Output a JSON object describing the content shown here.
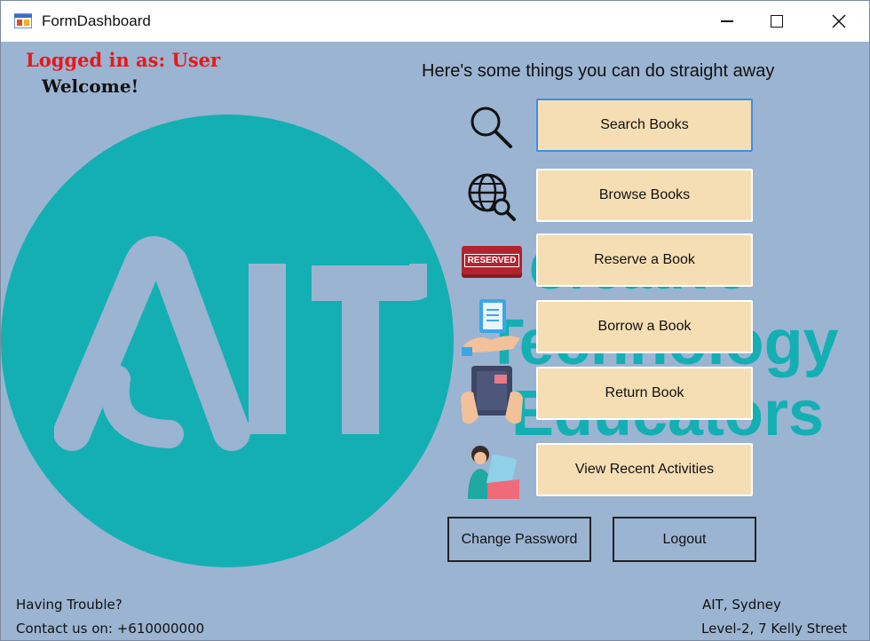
{
  "window": {
    "title": "FormDashboard"
  },
  "user": {
    "logged_in_label": "Logged in as: User",
    "welcome": "Welcome!"
  },
  "main": {
    "heading": "Here's some things you can do straight away",
    "actions": [
      {
        "label": "Search Books",
        "icon": "search-icon"
      },
      {
        "label": "Browse Books",
        "icon": "globe-search-icon"
      },
      {
        "label": "Reserve a Book",
        "icon": "reserved-stamp-icon",
        "icon_text": "RESERVED"
      },
      {
        "label": "Borrow a Book",
        "icon": "hand-book-icon"
      },
      {
        "label": "Return Book",
        "icon": "hands-book-icon"
      },
      {
        "label": "View Recent Activities",
        "icon": "person-activity-icon"
      }
    ],
    "change_password": "Change Password",
    "logout": "Logout"
  },
  "logo": {
    "letters": "AIT",
    "lines": [
      "Creative",
      "Technology",
      "Educators"
    ]
  },
  "footer": {
    "trouble": "Having Trouble?",
    "contact": "Contact us on: +610000000",
    "city": "AIT, Sydney",
    "address": "Level-2, 7 Kelly Street"
  },
  "colors": {
    "background": "#9bb4d2",
    "brand_teal": "#14afb3",
    "button_fill": "#f5deb4",
    "logged_text": "#e8181b"
  }
}
